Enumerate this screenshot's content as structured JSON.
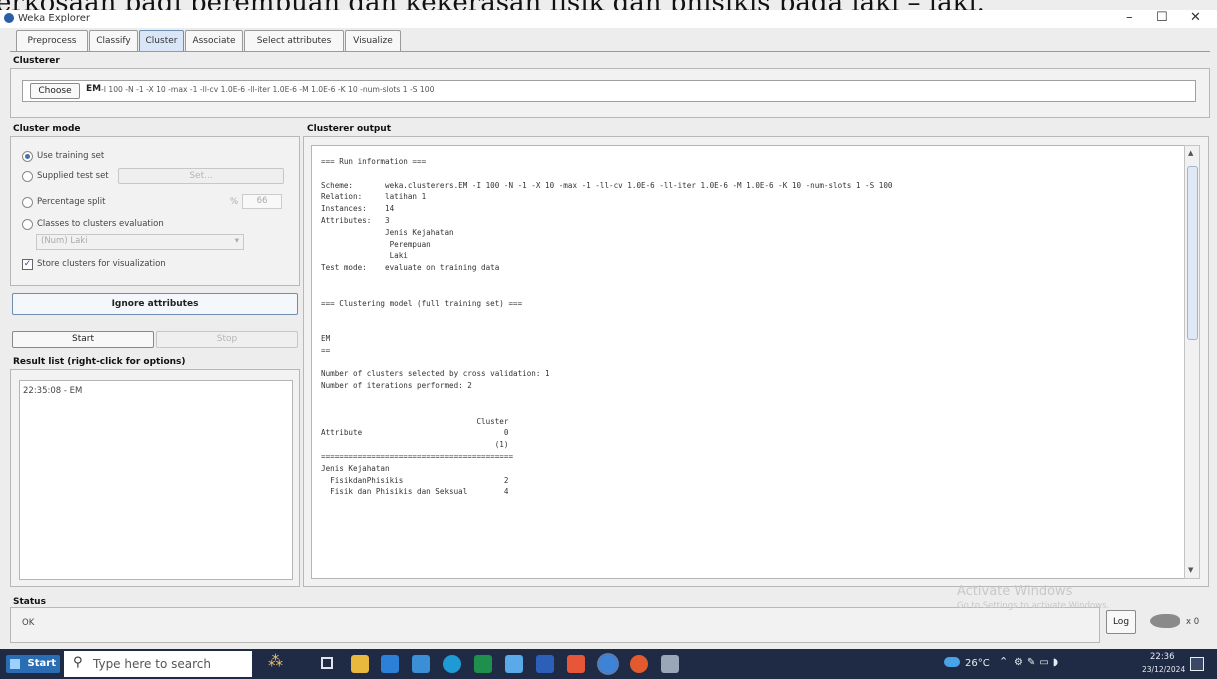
{
  "overlay_text": "erkosaan bagi perempuan dan kekerasan fisik dan phisikis pada laki – laki.",
  "window": {
    "title": "Weka Explorer",
    "controls": {
      "minimize": "–",
      "maximize": "☐",
      "close": "✕"
    }
  },
  "tabs": [
    "Preprocess",
    "Classify",
    "Cluster",
    "Associate",
    "Select attributes",
    "Visualize"
  ],
  "active_tab": "Cluster",
  "clusterer": {
    "section_title": "Clusterer",
    "choose_label": "Choose",
    "algorithm": "EM",
    "options": "-I 100 -N -1 -X 10 -max -1 -ll-cv 1.0E-6 -ll-iter 1.0E-6 -M 1.0E-6 -K 10 -num-slots 1 -S 100"
  },
  "cluster_mode": {
    "section_title": "Cluster mode",
    "use_training_set": "Use training set",
    "supplied_test_set": "Supplied test set",
    "set_label": "Set...",
    "percentage_split": "Percentage split",
    "percent_symbol": "%",
    "percent_value": "66",
    "classes_to_clusters": "Classes to clusters evaluation",
    "class_select": "(Num) Laki",
    "store_clusters": "Store clusters for visualization",
    "ignore_attributes": "Ignore attributes",
    "start": "Start",
    "stop": "Stop"
  },
  "result_list": {
    "title": "Result list (right-click for options)",
    "items": [
      "22:35:08 - EM"
    ]
  },
  "output": {
    "title": "Clusterer output",
    "lines": [
      "=== Run information ===",
      "",
      "Scheme:       weka.clusterers.EM -I 100 -N -1 -X 10 -max -1 -ll-cv 1.0E-6 -ll-iter 1.0E-6 -M 1.0E-6 -K 10 -num-slots 1 -S 100",
      "Relation:     latihan 1",
      "Instances:    14",
      "Attributes:   3",
      "              Jenis Kejahatan",
      "               Perempuan",
      "               Laki",
      "Test mode:    evaluate on training data",
      "",
      "",
      "=== Clustering model (full training set) ===",
      "",
      "",
      "EM",
      "==",
      "",
      "Number of clusters selected by cross validation: 1",
      "Number of iterations performed: 2",
      "",
      "",
      "                                  Cluster",
      "Attribute                               0",
      "                                      (1)",
      "==========================================",
      "Jenis Kejahatan",
      "  FisikdanPhisikis                      2",
      "  Fisik dan Phisikis dan Seksual        4"
    ]
  },
  "status": {
    "title": "Status",
    "text": "OK",
    "log_button": "Log",
    "count": "x 0"
  },
  "watermark": {
    "line1": "Activate Windows",
    "line2": "Go to Settings to activate Windows."
  },
  "taskbar": {
    "start_label": "Start",
    "search_placeholder": "Type here to search",
    "weather": "26°C",
    "time": "22:36",
    "date": "23/12/2024"
  },
  "colors": {
    "accent": "#0b64b0",
    "taskbar": "#1f2a44",
    "panel": "#f2f2f2"
  }
}
